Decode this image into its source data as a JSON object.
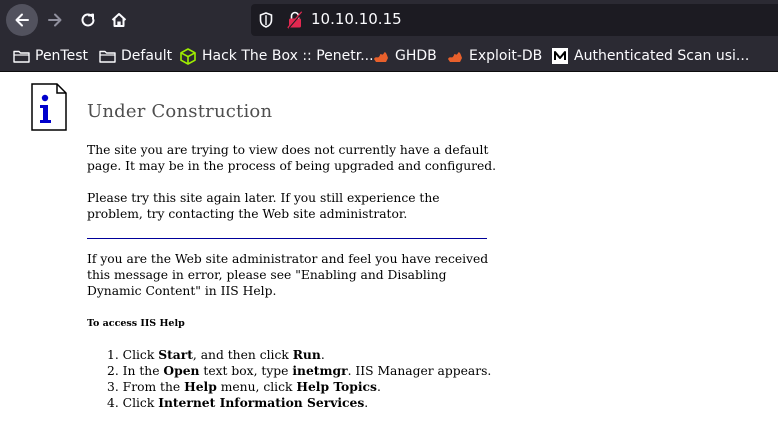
{
  "browser": {
    "url": "10.10.10.15",
    "bookmarks": [
      {
        "label": "PenTest",
        "icon": "folder-icon"
      },
      {
        "label": "Default",
        "icon": "folder-icon"
      },
      {
        "label": "Hack The Box :: Penetr...",
        "icon": "htb-cube-icon"
      },
      {
        "label": "GHDB",
        "icon": "exploitdb-icon"
      },
      {
        "label": "Exploit-DB",
        "icon": "exploitdb-icon"
      },
      {
        "label": "Authenticated Scan usi...",
        "icon": "medium-m-icon"
      }
    ]
  },
  "page": {
    "title": "Under Construction",
    "para1": "The site you are trying to view does not currently have a default page. It may be in the process of being upgraded and configured.",
    "para2": "Please try this site again later. If you still experience the problem, try contacting the Web site administrator.",
    "para3": "If you are the Web site administrator and feel you have received this message in error, please see \"Enabling and Disabling Dynamic Content\" in IIS Help.",
    "help_heading": "To access IIS Help",
    "steps": [
      {
        "n": "1.",
        "a": "Click ",
        "b1": "Start",
        "c": ", and then click ",
        "b2": "Run",
        "d": "."
      },
      {
        "n": "2.",
        "a": "In the ",
        "b1": "Open",
        "c": " text box, type ",
        "b2": "inetmgr",
        "d": ". IIS Manager appears."
      },
      {
        "n": "3.",
        "a": "From the ",
        "b1": "Help",
        "c": " menu, click ",
        "b2": "Help Topics",
        "d": "."
      },
      {
        "n": "4.",
        "a": "Click ",
        "b1": "Internet Information Services",
        "c": "",
        "b2": "",
        "d": "."
      }
    ]
  },
  "colors": {
    "toolbar_bg": "#2b2a33",
    "urlbar_bg": "#1c1b22",
    "rule": "#000099",
    "title": "#4e4e4e"
  }
}
